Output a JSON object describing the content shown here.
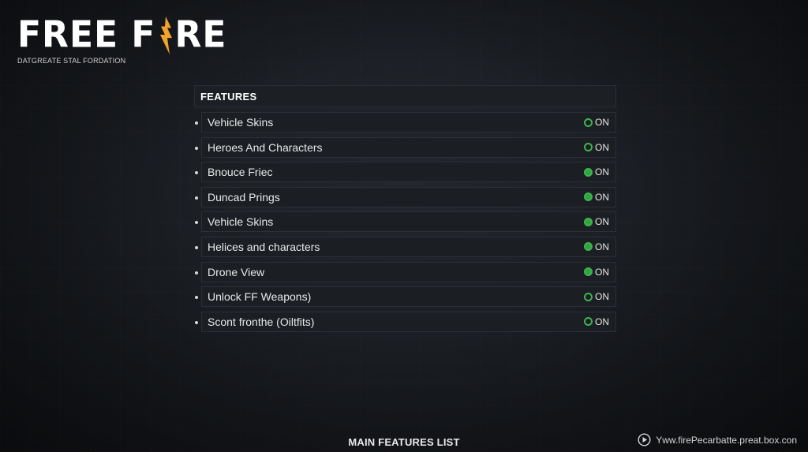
{
  "brand": {
    "logo_text_left": "FREE F",
    "logo_text_right": "RE",
    "tagline": "DATGREATE STAL FORDATION",
    "accent_color": "#f2a22a"
  },
  "panel": {
    "header": "FEATURES",
    "items": [
      {
        "label": "Vehicle Skins",
        "state": "ON",
        "style": "outline"
      },
      {
        "label": "Heroes And Characters",
        "state": "ON",
        "style": "outline"
      },
      {
        "label": "Bnouce Friec",
        "state": "ON",
        "style": "filled"
      },
      {
        "label": "Duncad Prings",
        "state": "ON",
        "style": "filled"
      },
      {
        "label": "Vehicle Skins",
        "state": "ON",
        "style": "filled"
      },
      {
        "label": "Helices and characters",
        "state": "ON",
        "style": "filled"
      },
      {
        "label": "Drone View",
        "state": "ON",
        "style": "filled"
      },
      {
        "label": "Unlock FF Weapons)",
        "state": "ON",
        "style": "outline"
      },
      {
        "label": "Scont fronthe (Oiltfits)",
        "state": "ON",
        "style": "outline"
      }
    ],
    "toggle_color": "#3fb34f"
  },
  "footer": {
    "title": "MAIN FEATURES LIST",
    "watermark": "Yww.firePecarbatte.preat.box.con"
  }
}
